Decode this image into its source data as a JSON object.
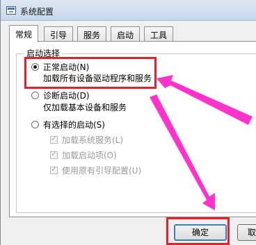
{
  "window": {
    "title": "系统配置",
    "icon": "system-config-icon"
  },
  "tabs": [
    {
      "label": "常规",
      "active": true
    },
    {
      "label": "引导",
      "active": false
    },
    {
      "label": "服务",
      "active": false
    },
    {
      "label": "启动",
      "active": false
    },
    {
      "label": "工具",
      "active": false
    }
  ],
  "startup_group": {
    "legend": "启动选择",
    "options": [
      {
        "label": "正常启动(N)",
        "description": "加载所有设备驱动程序和服务",
        "checked": true
      },
      {
        "label": "诊断启动(D)",
        "description": "仅加载基本设备和服务",
        "checked": false
      },
      {
        "label": "有选择的启动(S)",
        "checked": false
      }
    ],
    "selective_items": [
      {
        "label": "加载系统服务(L)",
        "checked": true
      },
      {
        "label": "加载启动项(O)",
        "checked": true
      },
      {
        "label": "使用原有引导配置(U)",
        "checked": true
      }
    ]
  },
  "buttons": {
    "ok": "确定",
    "cancel": "取"
  },
  "annotation": {
    "highlight_color": "#e4202a",
    "arrow_color": "#ff33cc"
  }
}
